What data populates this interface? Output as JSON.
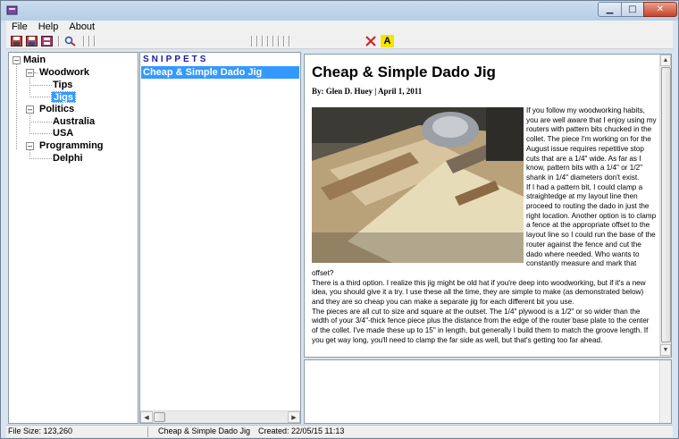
{
  "menu": [
    "File",
    "Help",
    "About"
  ],
  "tree": {
    "root": "Main",
    "woodwork": "Woodwork",
    "tips": "Tips",
    "jigs": "Jigs",
    "politics": "Politics",
    "australia": "Australia",
    "usa": "USA",
    "programming": "Programming",
    "delphi": "Delphi"
  },
  "snippets": {
    "header": "SNIPPETS",
    "items": [
      "Cheap & Simple Dado Jig"
    ]
  },
  "article": {
    "title": "Cheap & Simple Dado Jig",
    "byline": "By: Glen D. Huey | April 1, 2011",
    "p1": "If you follow my woodworking habits, you are well aware that I enjoy using my routers with pattern bits chucked in the collet. The piece I'm working on for the August issue requires repetitive stop cuts that are a 1/4\" wide. As far as I know, pattern bits with a 1/4\" or 1/2\" shank in 1/4\" diameters don't exist.",
    "p2": "If I had a pattern bit, I could clamp a straightedge at my layout line then proceed to routing the dado in just the right location. Another option is to clamp a fence at the appropriate offset to the layout line so I could run the base of the router against the fence and cut the dado where needed. Who wants to constantly measure and mark that offset?",
    "p3": "There is a third option. I realize this jig might be old hat if you're deep into woodworking, but if it's a new idea, you should give it a try. I use these all the time, they are simple to make (as demonstrated below) and they are so cheap you can make a separate jig for each different bit you use.",
    "p4": "The pieces are all cut to size and square at the outset. The 1/4\" plywood is a 1/2\" or so wider than the width of your 3/4\"-thick fence piece plus the distance from the edge of the router base plate to the center of the collet. I've made these up to 15\" in length, but generally I build them to match the groove length. If you get way long, you'll need to clamp the far side as well, but that's getting too far ahead."
  },
  "status": {
    "file_size": "File Size: 123,260",
    "snippet": "Cheap & Simple Dado Jig",
    "created": "Created: 22/05/15 11:13"
  },
  "colors": {
    "selection": "#3399ff",
    "snippets_header": "#1a1aa6",
    "close_button": "#c7432a"
  }
}
